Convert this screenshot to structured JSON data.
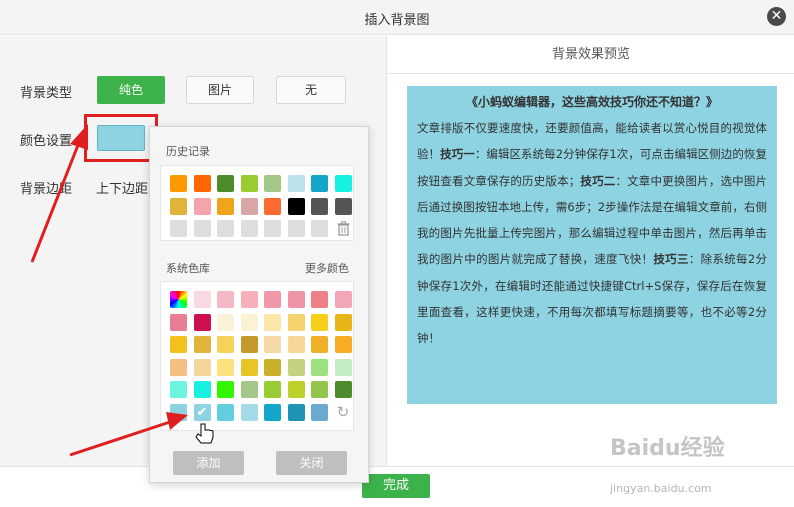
{
  "dialog": {
    "title": "插入背景图",
    "close_glyph": "✕"
  },
  "form": {
    "bg_type_label": "背景类型",
    "type_options": [
      "纯色",
      "图片",
      "无"
    ],
    "color_label": "颜色设置",
    "selected_color": "#8dd3e2",
    "margin_label": "背景边距",
    "margin_value": "上下边距"
  },
  "picker": {
    "history_label": "历史记录",
    "history_colors": [
      "#ff9900",
      "#ff6600",
      "#4e8c2b",
      "#99cc33",
      "#a3c88a",
      "#bde1eb",
      "#13a6c8",
      "#16f1e0",
      "#e0b43a",
      "#f4a4ac",
      "#f0a31c",
      "#d9a6a6",
      "#ff6a2e",
      "#000000",
      "#555555",
      "#555555",
      "#dddddd",
      "#dddddd",
      "#dddddd",
      "#dddddd",
      "#dddddd",
      "#dddddd",
      "#dddddd"
    ],
    "system_label": "系统色库",
    "more_label": "更多颜色",
    "system_colors": [
      "rainbow",
      "#f8d9e0",
      "#f4b8c5",
      "#f6b0b9",
      "#f197aa",
      "#f094a8",
      "#ef7f86",
      "#f3a7b6",
      "#e97e92",
      "#cc1050",
      "#fbf3d9",
      "#fcf1d2",
      "#fce7a8",
      "#f5d46e",
      "#f6cf1b",
      "#e8b516",
      "#f4c11c",
      "#e0b43a",
      "#f5d35b",
      "#c39a2a",
      "#f5d9a5",
      "#f8d698",
      "#f0b027",
      "#f8ad24",
      "#f4bf83",
      "#f5d59a",
      "#fbe27e",
      "#e8c424",
      "#c8b02a",
      "#c3d27e",
      "#9de080",
      "#c3ecc2",
      "#6bf4e0",
      "#19f1e0",
      "#34f500",
      "#a3c88a",
      "#99cc33",
      "#bed12b",
      "#92c54b",
      "#4e8c2b",
      "#8dd3e2",
      "selected",
      "#65cde0",
      "#a5dbe6",
      "#13a6c8",
      "#1e95b6",
      "#6aaace",
      "refresh"
    ],
    "add_label": "添加",
    "close_label": "关闭"
  },
  "preview": {
    "header": "背景效果预览",
    "title": "《小蚂蚁编辑器，这些高效技巧你还不知道？》",
    "body_segments": [
      {
        "text": "文章排版不仅要速度快，还要颜值高，能给读者以赏心悦目的视觉体验！",
        "bold": false
      },
      {
        "text": "技巧一",
        "bold": true
      },
      {
        "text": "：编辑区系统每2分钟保存1次，可点击编辑区侧边的恢复按钮查看文章保存的历史版本；",
        "bold": false
      },
      {
        "text": "技巧二",
        "bold": true
      },
      {
        "text": "：文章中更换图片，选中图片后通过换图按钮本地上传，需6步；2步操作法是在编辑文章前，右侧我的图片先批量上传完图片，那么编辑过程中单击图片，然后再单击我的图片中的图片就完成了替换，速度飞快！",
        "bold": false
      },
      {
        "text": "技巧三",
        "bold": true
      },
      {
        "text": "：除系统每2分钟保存1次外，在编辑时还能通过快捷键Ctrl+S保存，保存后在恢复里面查看，这样更快速，不用每次都填写标题摘要等，也不必等2分钟！",
        "bold": false
      }
    ],
    "background_color": "#8dd3e2"
  },
  "footer": {
    "done_label": "完成"
  },
  "watermark": {
    "main": "Baidu经验",
    "sub": "jingyan.baidu.com"
  },
  "colors": {
    "accent": "#3cb34a",
    "highlight": "#e02020"
  }
}
